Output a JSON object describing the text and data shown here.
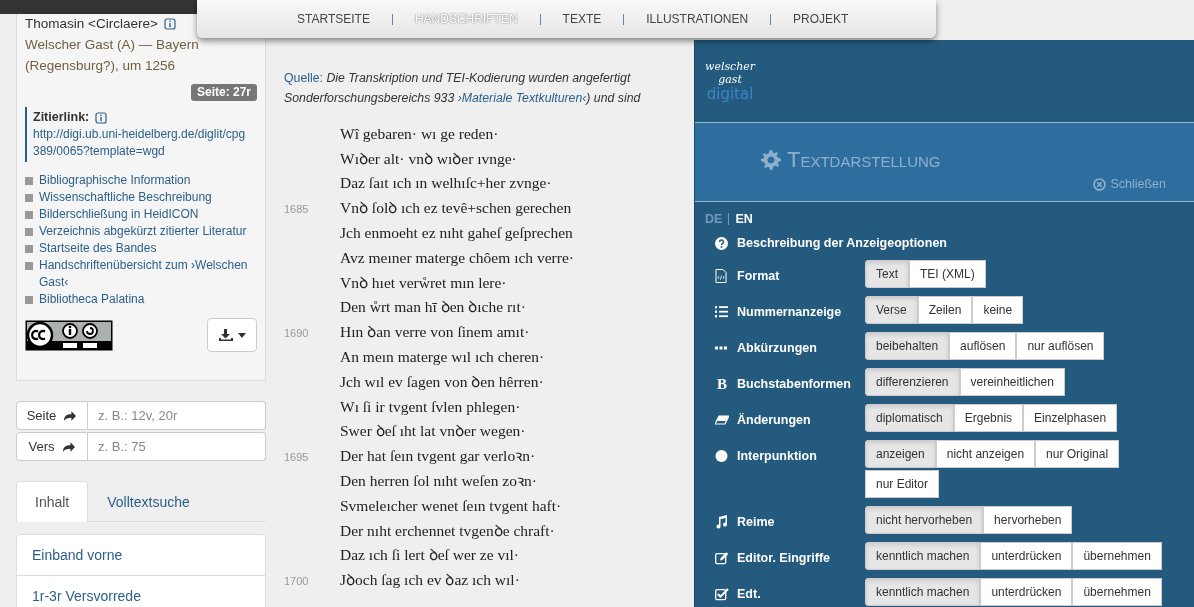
{
  "nav": {
    "items": [
      {
        "label": "STARTSEITE",
        "selected": false
      },
      {
        "label": "HANDSCHRIFTEN",
        "selected": true
      },
      {
        "label": "TEXTE",
        "selected": false
      },
      {
        "label": "ILLUSTRATIONEN",
        "selected": false
      },
      {
        "label": "PROJEKT",
        "selected": false
      }
    ]
  },
  "sidebar": {
    "author": "Thomasin <Circlaere>",
    "work": "Welscher Gast (A) — Bayern (Regensburg?), um 1256",
    "page_badge": "Seite: 27r",
    "citation": {
      "label": "Zitierlink:",
      "url": "http://digi.ub.uni-heidelberg.de/diglit/cpg389/0065?template=wgd"
    },
    "links": [
      "Bibliographische Information",
      "Wissenschaftliche Beschreibung",
      "Bilderschließung in HeidICON",
      "Verzeichnis abgekürzt zitierter Literatur",
      "Startseite des Bandes",
      "Handschriftenübersicht zum ›Welschen Gast‹",
      "Bibliotheca Palatina"
    ],
    "jump": [
      {
        "label": "Seite",
        "placeholder": "z. B.: 12v, 20r"
      },
      {
        "label": "Vers",
        "placeholder": "z. B.: 75"
      }
    ],
    "tabs": [
      {
        "label": "Inhalt",
        "selected": true
      },
      {
        "label": "Volltextsuche",
        "selected": false
      }
    ],
    "contents": [
      "Einband vorne",
      "1r-3r Versvorrede"
    ]
  },
  "source": {
    "label": "Quelle:",
    "lines": [
      [
        {
          "kind": "text",
          "text": "Die Transkription und TEI-Kodierung wurden angefertigt"
        }
      ],
      [
        {
          "kind": "text",
          "text": "Sonderforschungsbereichs 933 "
        },
        {
          "kind": "link",
          "text": "›Materiale Textkulturen‹"
        },
        {
          "kind": "text",
          "text": ") und sind"
        }
      ]
    ]
  },
  "verses": [
    {
      "text": "Wî gebaren· wı ge reden·"
    },
    {
      "text": "Wıꝺer alt· vnꝺ wıꝺer ıvnge·"
    },
    {
      "text": "Daz ſaıt ıch ın welhıſc+her zvnge·"
    },
    {
      "number": "1685",
      "text": "Vnꝺ ſolꝺ ıch ez tevê+schen gerechen"
    },
    {
      "text": "Jch enmoeht ez nıht gaheſ geſprechen"
    },
    {
      "text": "Avz meıner materge chôem ıch verre·"
    },
    {
      "text": "Vnꝺ hıet verẘret mın lere·"
    },
    {
      "text": "Den ẘrt man hī ꝺen ꝺıche rıt·"
    },
    {
      "number": "1690",
      "text": "Hın ꝺan verre von ſinem amıt·"
    },
    {
      "text": "An meın materge wıl ıch cheren·"
    },
    {
      "text": "Jch wıl ev ſagen von ꝺen hêrren·"
    },
    {
      "text": "Wı ſi ir tvgent ſvlen phlegen·"
    },
    {
      "text": "Swer ꝺeſ ıht lat vnꝺer wegen·"
    },
    {
      "number": "1695",
      "text": "Der hat ſeın tvgent gar verloꝛn·"
    },
    {
      "text": "Den herren ſol nıht weſen zoꝛn·"
    },
    {
      "text": "Svmeleıcher wenet ſeın tvgent haft·"
    },
    {
      "text": "Der nıht erchennet tvgenꝺe chraft·"
    },
    {
      "text": "Daz ıch ſi lert ꝺeſ wer ze vıl·"
    },
    {
      "number": "1700",
      "text": "Jꝺoch ſag ıch ev ꝺaz ıch wıl·"
    }
  ],
  "panel": {
    "logo": {
      "line_1": "welscher",
      "line_2": "gast",
      "line_3": "digital"
    },
    "title": "Textdarstellung",
    "close": "Schließen",
    "languages": [
      {
        "label": "DE",
        "selected": false
      },
      {
        "label": "EN",
        "selected": true
      }
    ],
    "help": "Beschreibung der Anzeigeoptionen",
    "options": [
      {
        "kind": "format",
        "label": "Format",
        "buttons": [
          {
            "label": "Text",
            "selected": true
          },
          {
            "label": "TEI (XML)",
            "selected": false
          }
        ]
      },
      {
        "kind": "numbers",
        "label": "Nummernanzeige",
        "buttons": [
          {
            "label": "Verse",
            "selected": true
          },
          {
            "label": "Zeilen",
            "selected": false
          },
          {
            "label": "keine",
            "selected": false
          }
        ]
      },
      {
        "kind": "abbreviations",
        "label": "Abkürzungen",
        "buttons": [
          {
            "label": "beibehalten",
            "selected": true
          },
          {
            "label": "auflösen",
            "selected": false
          },
          {
            "label": "nur auflösen",
            "selected": false
          }
        ]
      },
      {
        "kind": "letterforms",
        "glyph": "B",
        "label": "Buchstabenformen",
        "buttons": [
          {
            "label": "differenzieren",
            "selected": true
          },
          {
            "label": "vereinheitlichen",
            "selected": false
          }
        ]
      },
      {
        "kind": "changes",
        "label": "Änderungen",
        "buttons": [
          {
            "label": "diplomatisch",
            "selected": true
          },
          {
            "label": "Ergebnis",
            "selected": false
          },
          {
            "label": "Einzelphasen",
            "selected": false
          }
        ]
      },
      {
        "kind": "punctuation",
        "label": "Interpunktion",
        "buttons": [
          {
            "label": "anzeigen",
            "selected": true
          },
          {
            "label": "nicht anzeigen",
            "selected": false
          },
          {
            "label": "nur Original",
            "selected": false
          },
          {
            "label": "nur Editor",
            "selected": false
          }
        ]
      },
      {
        "kind": "rhymes",
        "label": "Reime",
        "buttons": [
          {
            "label": "nicht hervorheben",
            "selected": true
          },
          {
            "label": "hervorheben",
            "selected": false
          }
        ]
      },
      {
        "kind": "edits",
        "label": "Editor. Eingriffe",
        "buttons": [
          {
            "label": "kenntlich machen",
            "selected": true
          },
          {
            "label": "unterdrücken",
            "selected": false
          },
          {
            "label": "übernehmen",
            "selected": false
          }
        ]
      },
      {
        "kind": "checked",
        "label": "Edt.",
        "buttons": [
          {
            "label": "kenntlich machen",
            "selected": true
          },
          {
            "label": "unterdrücken",
            "selected": false
          },
          {
            "label": "übernehmen",
            "selected": false
          }
        ]
      }
    ]
  }
}
